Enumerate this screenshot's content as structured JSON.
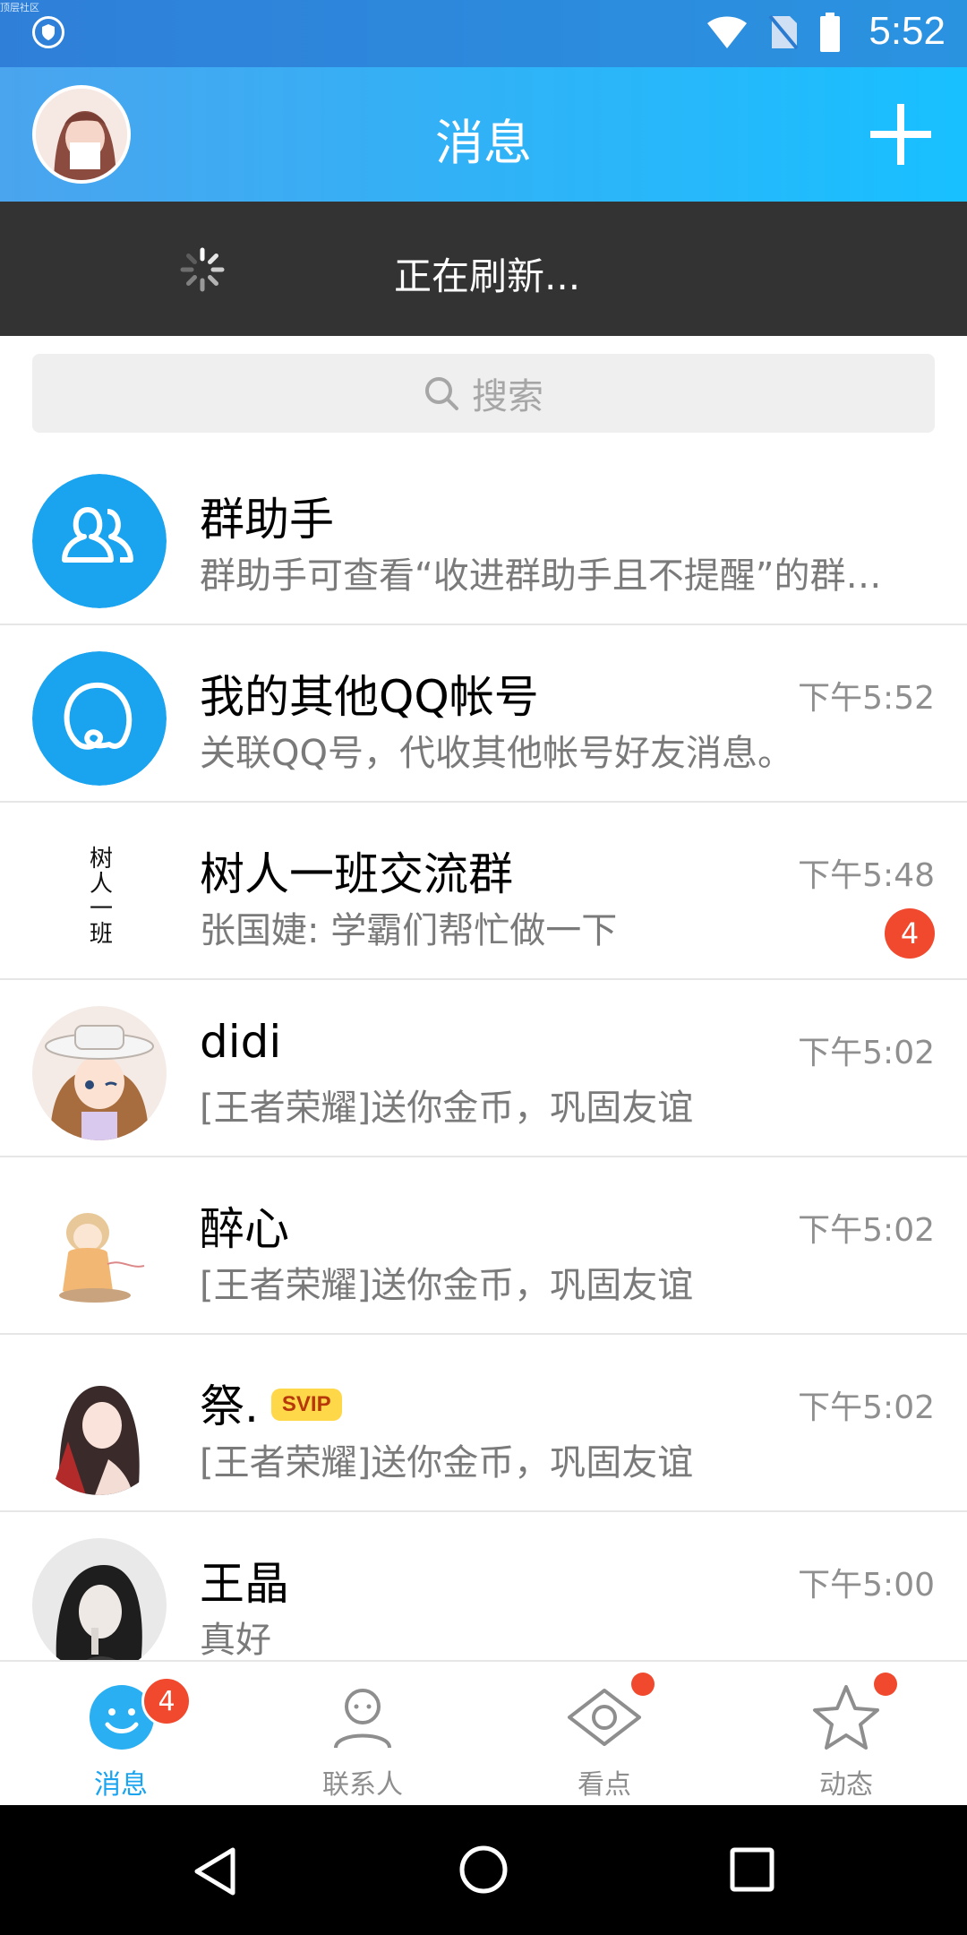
{
  "status_bar": {
    "tiny_label": "顶层社区",
    "time": "5:52",
    "icons": [
      "shield-icon",
      "wifi-icon",
      "no-sim-icon",
      "battery-icon"
    ]
  },
  "header": {
    "title": "消息",
    "right_icon": "plus-icon"
  },
  "refresh": {
    "text": "正在刷新..."
  },
  "search": {
    "placeholder": "搜索"
  },
  "conversations": [
    {
      "name": "群助手",
      "message": "群助手可查看“收进群助手且不提醒”的群…",
      "time": "",
      "unread": null
    },
    {
      "name": "我的其他QQ帐号",
      "message": "关联QQ号，代收其他帐号好友消息。",
      "time": "下午5:52",
      "unread": null
    },
    {
      "name": "树人一班交流群",
      "message": "张国婕: 学霸们帮忙做一下",
      "time": "下午5:48",
      "unread": "4"
    },
    {
      "name": "didi",
      "message": "[王者荣耀]送你金币，巩固友谊",
      "time": "下午5:02",
      "unread": null
    },
    {
      "name": "醉心",
      "message": "[王者荣耀]送你金币，巩固友谊",
      "time": "下午5:02",
      "unread": null
    },
    {
      "name": "祭.",
      "badge": "SVIP",
      "message": "[王者荣耀]送你金币，巩固友谊",
      "time": "下午5:02",
      "unread": null
    },
    {
      "name": "王晶",
      "message": "真好",
      "time": "下午5:00",
      "unread": null
    }
  ],
  "group_avatar_text": "树人一班",
  "tabs": [
    {
      "label": "消息",
      "badge": "4",
      "active": true
    },
    {
      "label": "联系人"
    },
    {
      "label": "看点",
      "dot": true
    },
    {
      "label": "动态",
      "dot": true
    }
  ],
  "colors": {
    "accent": "#1aa4f0",
    "unread": "#f1492d",
    "refresh_bg": "#333333",
    "svip_bg": "#ffd84a"
  }
}
